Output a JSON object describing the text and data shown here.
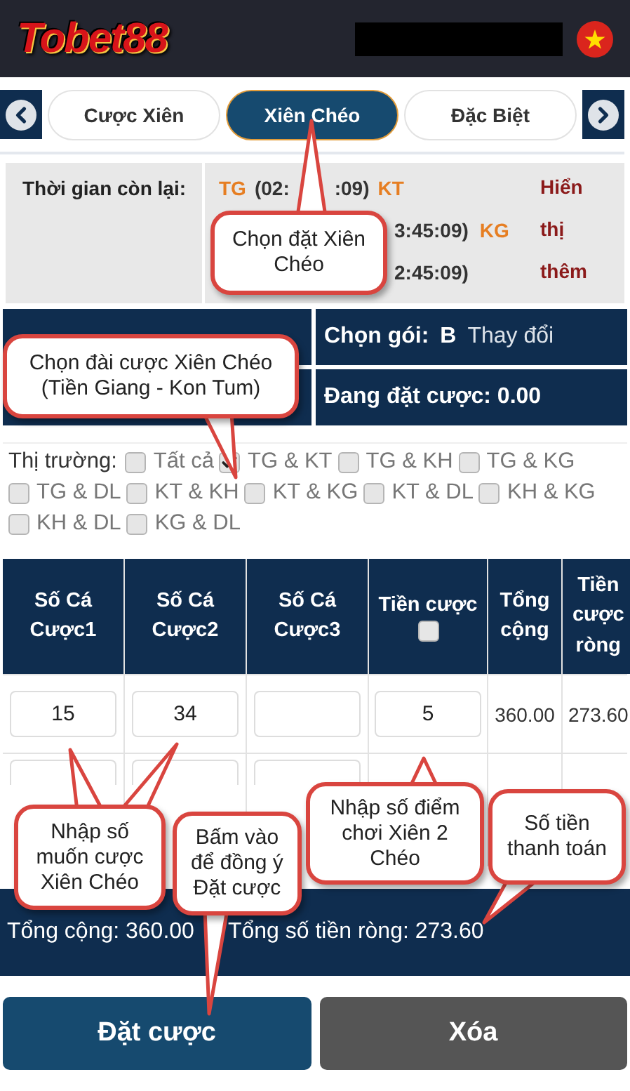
{
  "header": {
    "logo": "Tobet88"
  },
  "tabs": [
    {
      "label": "Cược Xiên",
      "selected": false
    },
    {
      "label": "Xiên Chéo",
      "selected": true
    },
    {
      "label": "Đặc Biệt",
      "selected": false
    }
  ],
  "timer": {
    "label": "Thời gian còn lại:",
    "rows": [
      [
        {
          "kind": "code",
          "text": "TG"
        },
        {
          "kind": "time",
          "text": "(02:"
        },
        {
          "kind": "time",
          "text": ":09)"
        },
        {
          "kind": "code",
          "text": "KT"
        }
      ],
      [
        {
          "kind": "time",
          "text": "3:45:09)"
        },
        {
          "kind": "code",
          "text": "KG"
        }
      ],
      [
        {
          "kind": "time",
          "text": "2:45:09)"
        }
      ]
    ],
    "more": [
      "Hiển",
      "thị",
      "thêm"
    ]
  },
  "package": {
    "label": "Chọn gói:",
    "value": "B",
    "action": "Thay đổi"
  },
  "betting": {
    "text": "Đang đặt cược: 0.00"
  },
  "markets": {
    "label": "Thị trường:",
    "options": [
      {
        "label": "Tất cả",
        "checked": false
      },
      {
        "label": "TG & KT",
        "checked": true
      },
      {
        "label": "TG & KH",
        "checked": false
      },
      {
        "label": "TG & KG",
        "checked": false
      },
      {
        "label": "TG & DL",
        "checked": false
      },
      {
        "label": "KT & KH",
        "checked": false
      },
      {
        "label": "KT & KG",
        "checked": false
      },
      {
        "label": "KT & DL",
        "checked": false
      },
      {
        "label": "KH & KG",
        "checked": false
      },
      {
        "label": "KH & DL",
        "checked": false
      },
      {
        "label": "KG & DL",
        "checked": false
      }
    ]
  },
  "table": {
    "columns": [
      "Số Cá Cược1",
      "Số Cá Cược2",
      "Số Cá Cược3",
      "Tiền cược",
      "Tổng cộng",
      "Tiền cược ròng"
    ],
    "stake_all_checked": false,
    "rows": [
      {
        "kind": "filled",
        "number1": "15",
        "number2": "34",
        "stake": "5",
        "total": "360.00",
        "net": "273.60"
      },
      {
        "kind": "blank"
      }
    ]
  },
  "summary": {
    "total": "Tổng cộng: 360.00",
    "net": "Tổng số tiền ròng: 273.60"
  },
  "buttons": [
    {
      "label": "Đặt cược",
      "kind": "primary"
    },
    {
      "label": "Xóa",
      "kind": "secondary"
    }
  ],
  "callouts": [
    {
      "text": "Chọn đặt Xiên Chéo"
    },
    {
      "text": "Chọn đài cược Xiên Chéo (Tiền Giang - Kon Tum)"
    },
    {
      "text": "Nhập số muốn cược Xiên Chéo"
    },
    {
      "text": "Bấm vào để đồng ý Đặt cược"
    },
    {
      "text": "Nhập số điểm chơi Xiên 2 Chéo"
    },
    {
      "text": "Số tiền thanh toán"
    }
  ]
}
